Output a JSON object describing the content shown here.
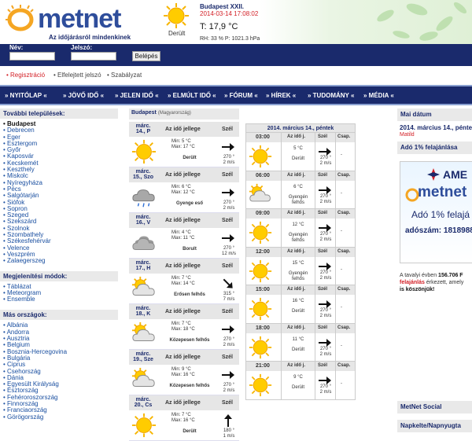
{
  "header": {
    "logo_text": "metnet",
    "tagline": "Az időjárásról mindenkinek",
    "condition": "Derült",
    "city": "Budapest XXII.",
    "datetime": "2014-03-14 17:08:02",
    "temperature": "T: 17,9 °C",
    "rh_pressure": "RH: 33 % P: 1021.3 hPa"
  },
  "login": {
    "name_label": "Név:",
    "password_label": "Jelszó:",
    "submit_label": "Belépés",
    "name_value": "",
    "password_value": ""
  },
  "links": {
    "register": "Regisztráció",
    "forgot": "Elfelejtett jelszó",
    "rules": "Szabályzat"
  },
  "nav": [
    "» NYITÓLAP «",
    "» JÖVŐ IDŐ «",
    "» JELEN IDŐ «",
    "» ELMÚLT IDŐ «",
    "» FÓRUM «",
    "» HÍREK «",
    "» TUDOMÁNY «",
    "» MÉDIA «"
  ],
  "left": {
    "settlements_title": "További települések:",
    "settlements": [
      "Budapest",
      "Debrecen",
      "Eger",
      "Esztergom",
      "Győr",
      "Kaposvár",
      "Kecskemét",
      "Keszthely",
      "Miskolc",
      "Nyíregyháza",
      "Pécs",
      "Salgótarján",
      "Siófok",
      "Sopron",
      "Szeged",
      "Szekszárd",
      "Szolnok",
      "Szombathely",
      "Székesfehérvár",
      "Velence",
      "Veszprém",
      "Zalaegerszeg"
    ],
    "display_title": "Megjelenítési módok:",
    "display_modes": [
      "Táblázat",
      "Meteorgram",
      "Ensemble"
    ],
    "countries_title": "Más országok:",
    "countries": [
      "Albánia",
      "Andorra",
      "Ausztria",
      "Belgium",
      "Bosznia-Hercegovina",
      "Bulgária",
      "Ciprus",
      "Csehország",
      "Dánia",
      "Egyesült Királyság",
      "Észtország",
      "Fehéroroszország",
      "Finnország",
      "Franciaország",
      "Görögország"
    ]
  },
  "daily": {
    "city": "Budapest",
    "country": "(Magyarország)",
    "col_weather": "Az idő jellege",
    "col_wind": "Szél",
    "rows": [
      {
        "date": "márc. 14., P",
        "icon": "sun-icon",
        "min": "Min: 5 °C",
        "max": "Max: 17 °C",
        "cond": "Derült",
        "dir": 90,
        "deg": "270 °",
        "speed": "2 m/s"
      },
      {
        "date": "márc. 15., Szo",
        "icon": "cloud-rain-icon",
        "min": "Min: 6 °C",
        "max": "Max: 12 °C",
        "cond": "Gyenge eső",
        "dir": 90,
        "deg": "270 °",
        "speed": "2 m/s"
      },
      {
        "date": "márc. 16., V",
        "icon": "overcast-icon",
        "min": "Min: 4 °C",
        "max": "Max: 11 °C",
        "cond": "Borult",
        "dir": 90,
        "deg": "270 °",
        "speed": "12 m/s"
      },
      {
        "date": "márc. 17., H",
        "icon": "partly-cloudy-icon",
        "min": "Min: 7 °C",
        "max": "Max: 14 °C",
        "cond": "Erősen felhős",
        "dir": 135,
        "deg": "315 °",
        "speed": "7 m/s"
      },
      {
        "date": "márc. 18., K",
        "icon": "partly-cloudy-icon",
        "min": "Min: 7 °C",
        "max": "Max: 18 °C",
        "cond": "Közepesen felhős",
        "dir": 90,
        "deg": "270 °",
        "speed": "2 m/s"
      },
      {
        "date": "márc. 19., Sze",
        "icon": "partly-cloudy-icon",
        "min": "Min: 9 °C",
        "max": "Max: 16 °C",
        "cond": "Közepesen felhős",
        "dir": 90,
        "deg": "270 °",
        "speed": "2 m/s"
      },
      {
        "date": "márc. 20., Cs",
        "icon": "sun-icon",
        "min": "Min: 7 °C",
        "max": "Max: 16 °C",
        "cond": "Derült",
        "dir": 0,
        "deg": "180 °",
        "speed": "1 m/s"
      }
    ]
  },
  "hourly": {
    "title": "2014. március 14., péntek",
    "col_weather": "Az idő j.",
    "col_wind": "Szél",
    "col_precip": "Csap.",
    "rows": [
      {
        "time": "03:00",
        "icon": "sun-icon",
        "temp": "5 °C",
        "cond": "Derült",
        "dir": 90,
        "deg": "270 °",
        "speed": "2 m/s",
        "precip": "-"
      },
      {
        "time": "06:00",
        "icon": "partly-cloudy-icon",
        "temp": "6 °C",
        "cond": "Gyengén felhős",
        "dir": 90,
        "deg": "270 °",
        "speed": "2 m/s",
        "precip": "-"
      },
      {
        "time": "09:00",
        "icon": "sun-icon",
        "temp": "12 °C",
        "cond": "Gyengén felhős",
        "dir": 90,
        "deg": "270 °",
        "speed": "2 m/s",
        "precip": "-"
      },
      {
        "time": "12:00",
        "icon": "sun-icon",
        "temp": "15 °C",
        "cond": "Gyengén felhős",
        "dir": 90,
        "deg": "270 °",
        "speed": "2 m/s",
        "precip": "-"
      },
      {
        "time": "15:00",
        "icon": "sun-icon",
        "temp": "16 °C",
        "cond": "Derült",
        "dir": 90,
        "deg": "270 °",
        "speed": "2 m/s",
        "precip": "-"
      },
      {
        "time": "18:00",
        "icon": "sun-icon",
        "temp": "11 °C",
        "cond": "Derült",
        "dir": 90,
        "deg": "270 °",
        "speed": "2 m/s",
        "precip": "-"
      },
      {
        "time": "21:00",
        "icon": "sun-icon",
        "temp": "9 °C",
        "cond": "Derült",
        "dir": 90,
        "deg": "270 °",
        "speed": "2 m/s",
        "precip": "-"
      }
    ]
  },
  "right": {
    "date_title": "Mai dátum",
    "date": "2014. március 14., péntek",
    "nameday": "Matild",
    "offer_title": "Adó 1% felajánlása",
    "ad_line1": "AME",
    "ad_line2": "metnet",
    "ad_line3": "Adó 1% felajá",
    "ad_line4": "adószám: 1818988",
    "text_a": "A tavalyi évben",
    "text_b": "156.706 F",
    "text_c": "felajánlás",
    "text_d": "érkezett, amely",
    "text_e": "is köszönjük!",
    "social_title": "MetNet Social",
    "social_sub": "Napkelte/Napnyugta"
  }
}
